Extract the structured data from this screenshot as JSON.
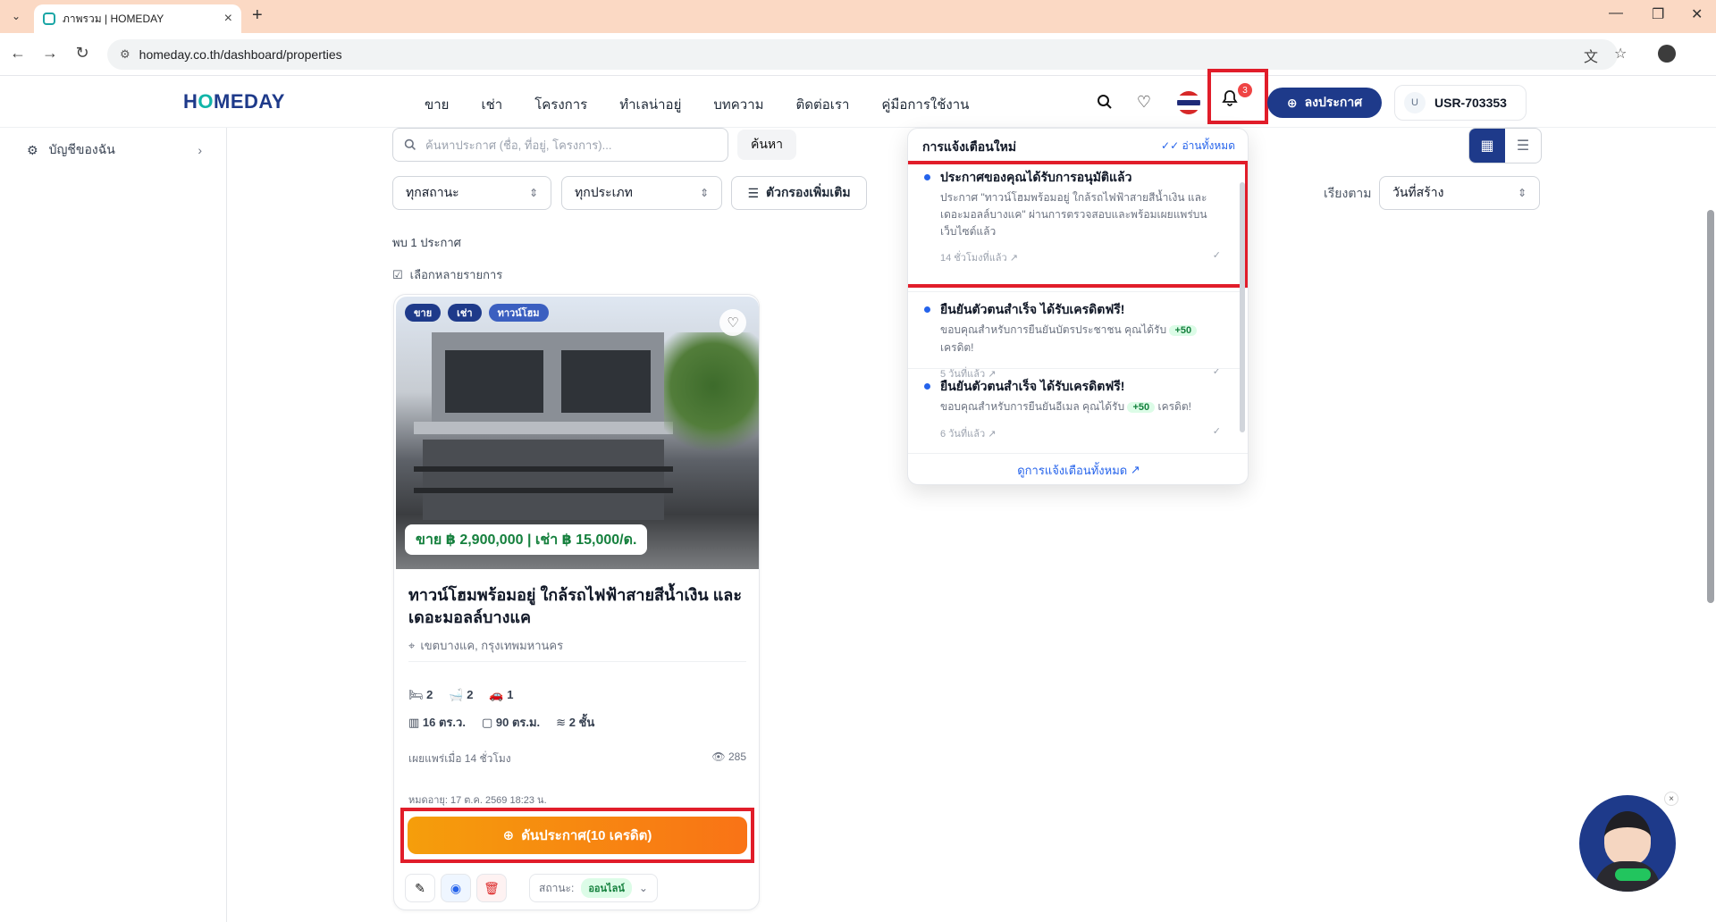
{
  "browser": {
    "tab_title": "ภาพรวม | HOMEDAY",
    "url": "homeday.co.th/dashboard/properties"
  },
  "header": {
    "logo_left": "H",
    "logo_o": "O",
    "logo_right": "MEDAY",
    "nav": [
      "ขาย",
      "เช่า",
      "โครงการ",
      "ทำเลน่าอยู่",
      "บทความ",
      "ติดต่อเรา",
      "คู่มือการใช้งาน"
    ],
    "notification_count": "3",
    "post_button": "ลงประกาศ",
    "user_initial": "U",
    "user_id": "USR-703353"
  },
  "sidebar": {
    "items": [
      {
        "label": "บัญชีของฉัน"
      }
    ]
  },
  "toolbar": {
    "search_placeholder": "ค้นหาประกาศ (ชื่อ, ที่อยู่, โครงการ)...",
    "search_button": "ค้นหา",
    "status_filter": "ทุกสถานะ",
    "type_filter": "ทุกประเภท",
    "more_filters": "ตัวกรองเพิ่มเติม",
    "sort_label": "เรียงตาม",
    "sort_value": "วันที่สร้าง"
  },
  "results": {
    "found": "พบ 1 ประกาศ",
    "multi_select": "เลือกหลายรายการ"
  },
  "listing": {
    "tags": [
      "ขาย",
      "เช่า",
      "ทาวน์โฮม"
    ],
    "price": "ขาย ฿ 2,900,000 | เช่า ฿ 15,000/ด.",
    "title": "ทาวน์โฮมพร้อมอยู่ ใกล้รถไฟฟ้าสายสีน้ำเงิน และเดอะมอลล์บางแค",
    "location": "เขตบางแค, กรุงเทพมหานคร",
    "bedrooms": "2",
    "bathrooms": "2",
    "parking": "1",
    "land_size": "16 ตร.ว.",
    "usable_area": "90 ตร.ม.",
    "floors": "2 ชั้น",
    "published": "เผยแพร่เมื่อ 14 ชั่วโมง",
    "views": "285",
    "expire": "หมดอายุ: 17 ต.ค. 2569 18:23 น.",
    "boost_button": "ดันประกาศ(10 เครดิต)",
    "status_label": "สถานะ:",
    "status_value": "ออนไลน์"
  },
  "notifications": {
    "title": "การแจ้งเตือนใหม่",
    "read_all": "อ่านทั้งหมด",
    "items": [
      {
        "title": "ประกาศของคุณได้รับการอนุมัติแล้ว",
        "body": "ประกาศ \"ทาวน์โฮมพร้อมอยู่ ใกล้รถไฟฟ้าสายสีน้ำเงิน และเดอะมอลล์บางแค\" ผ่านการตรวจสอบและพร้อมเผยแพร่บนเว็บไซต์แล้ว",
        "time": "14 ชั่วโมงที่แล้ว"
      },
      {
        "title": "ยืนยันตัวตนสำเร็จ ได้รับเครดิตฟรี!",
        "body_before": "ขอบคุณสำหรับการยืนยันบัตรประชาชน คุณได้รับ",
        "plus": "+50",
        "body_after": "เครดิต!",
        "time": "5 วันที่แล้ว"
      },
      {
        "title": "ยืนยันตัวตนสำเร็จ ได้รับเครดิตฟรี!",
        "body_before": "ขอบคุณสำหรับการยืนยันอีเมล คุณได้รับ",
        "plus": "+50",
        "body_after": "เครดิต!",
        "time": "6 วันที่แล้ว"
      }
    ],
    "view_all": "ดูการแจ้งเตือนทั้งหมด"
  },
  "colors": {
    "brand": "#1e3a8a",
    "accent": "#10b5a8",
    "boost": "#f97316",
    "highlight": "#e11d2a"
  }
}
